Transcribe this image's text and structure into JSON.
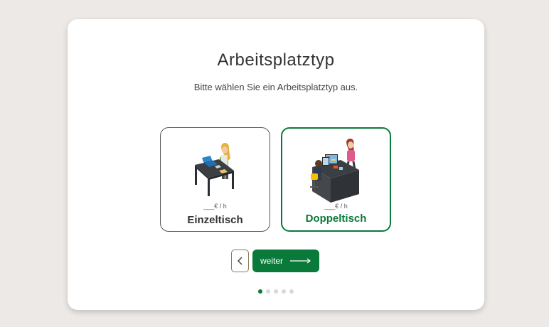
{
  "title": "Arbeitsplatztyp",
  "subtitle": "Bitte wählen Sie ein Arbeitsplatztyp aus.",
  "options": [
    {
      "label": "Einzeltisch",
      "price": "___€ / h",
      "selected": false
    },
    {
      "label": "Doppeltisch",
      "price": "___€ / h",
      "selected": true
    }
  ],
  "nav": {
    "back_icon": "chevron-left-icon",
    "next_label": "weiter",
    "next_icon": "arrow-right-icon"
  },
  "pagination": {
    "total": 5,
    "current": 1
  },
  "colors": {
    "accent": "#0a7a3b",
    "background": "#ece9e6",
    "card": "#ffffff"
  }
}
